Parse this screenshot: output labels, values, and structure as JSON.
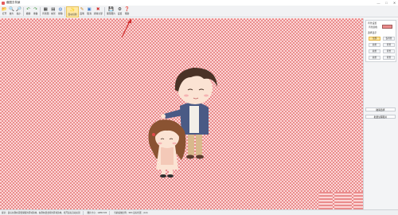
{
  "window": {
    "title": "截图去背景",
    "controls": [
      "—",
      "□",
      "✕"
    ]
  },
  "toolbar": {
    "items": [
      {
        "label": "打开",
        "icon": "folder-open-icon",
        "glyph": "📂"
      },
      {
        "label": "放大",
        "icon": "zoom-in-icon",
        "glyph": "🔍"
      },
      {
        "label": "缩小",
        "icon": "zoom-out-icon",
        "glyph": "🔎"
      },
      {
        "label": "撤销",
        "icon": "undo-icon",
        "glyph": "↶"
      },
      {
        "label": "重做",
        "icon": "redo-icon",
        "glyph": "↷"
      },
      {
        "label": "背景图",
        "icon": "image-icon",
        "glyph": "▦"
      },
      {
        "label": "前景",
        "icon": "layer-icon",
        "glyph": "▤"
      },
      {
        "label": "擦除",
        "icon": "eraser-icon",
        "glyph": "◍"
      },
      {
        "label": "自动识别",
        "icon": "magic-wand-icon",
        "glyph": "✨",
        "active": true
      },
      {
        "label": "画笔",
        "icon": "brush-icon",
        "glyph": "✎"
      },
      {
        "label": "取消",
        "icon": "rect-icon",
        "glyph": "▣"
      },
      {
        "label": "清除全部",
        "icon": "clear-icon",
        "glyph": "✖"
      },
      {
        "label": "保存图片",
        "icon": "save-icon",
        "glyph": "💾"
      },
      {
        "label": "设置",
        "icon": "settings-icon",
        "glyph": "⚙"
      },
      {
        "label": "帮助",
        "icon": "help-icon",
        "glyph": "❓"
      }
    ]
  },
  "colors": {
    "check_a": "#ea8c8c",
    "check_b": "#fbd6d6",
    "active_tool": "#ffe9a6",
    "accent_arrow": "#d12b2b"
  },
  "sidebar": {
    "panel_title": "背景设置",
    "color_label": "背景颜色",
    "section_title": "选择显示",
    "options": [
      "全部",
      "仅背景",
      "前景",
      "背景",
      "前景",
      "背景",
      "前景",
      "背景"
    ],
    "button1": "撤销选择",
    "button2": "批量处理图片"
  },
  "status": {
    "left": "提示：鼠标左键在需要保留的区域涂抹，右键在要去除的区域涂抹，松开鼠标自动识别",
    "middle": "图片大小：1280×720",
    "right": "当前缩放比例：30%  鼠标位置：(0,0)"
  }
}
